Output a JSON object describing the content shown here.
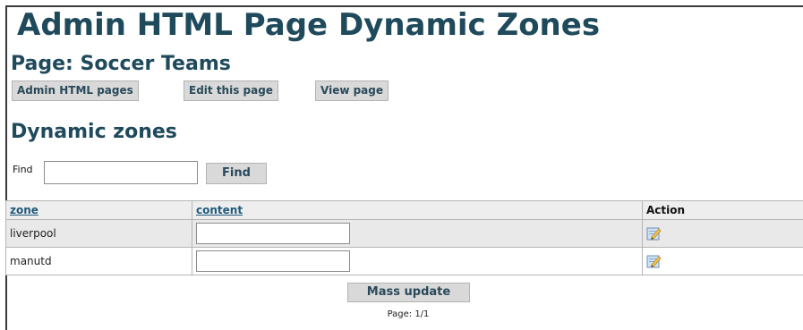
{
  "page": {
    "title": "Admin HTML Page Dynamic Zones",
    "subtitle": "Page: Soccer Teams"
  },
  "nav_buttons": {
    "admin_html_pages": "Admin HTML pages",
    "edit_this_page": "Edit this page",
    "view_page": "View page"
  },
  "section": {
    "title": "Dynamic zones"
  },
  "find": {
    "label": "Find",
    "value": "",
    "button_label": "Find"
  },
  "table": {
    "headers": {
      "zone": "zone",
      "content": "content",
      "action": "Action"
    },
    "rows": [
      {
        "zone": "liverpool",
        "content": "",
        "action_icon": "edit-icon"
      },
      {
        "zone": "manutd",
        "content": "",
        "action_icon": "edit-icon"
      }
    ]
  },
  "mass_update": {
    "label": "Mass update"
  },
  "pagination": {
    "text": "Page: 1/1"
  },
  "colors": {
    "heading": "#1f4a5c",
    "button_bg": "#d9d9d9",
    "link": "#1f5a7a",
    "row_alt": "#e9e9e9"
  }
}
